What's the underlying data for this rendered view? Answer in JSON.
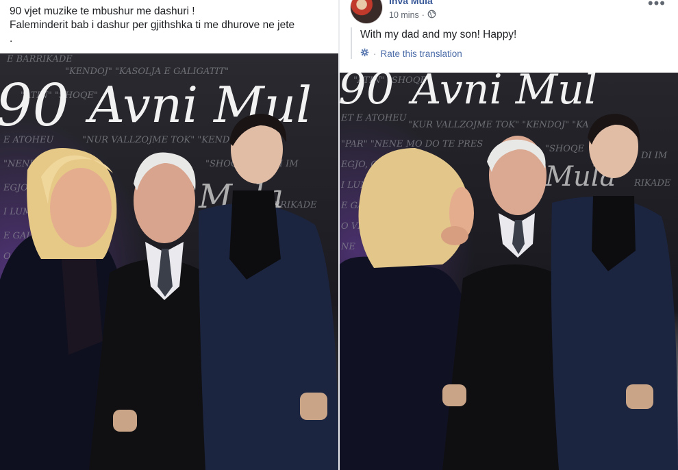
{
  "left_post": {
    "caption_line1": "90 vjet muzike te mbushur me dashuri !",
    "caption_line2": "Faleminderit bab i dashur per gjithshka ti me dhurove ne jete",
    "caption_line3": ".",
    "backdrop_text": "90 Avni Mula"
  },
  "right_post": {
    "author": "Inva Mula",
    "time": "10 mins",
    "separator": "·",
    "translated_text": "With my dad and my son! Happy!",
    "rate_label": "Rate this translation",
    "more_label": "•••",
    "backdrop_text": "90 Avni Mula"
  },
  "colors": {
    "link": "#385898",
    "rate": "#4b6ca8",
    "text": "#1c1e21",
    "meta": "#606770",
    "backdrop": "#15151a"
  },
  "icons": [
    "globe-icon",
    "gear-icon",
    "more-icon"
  ]
}
